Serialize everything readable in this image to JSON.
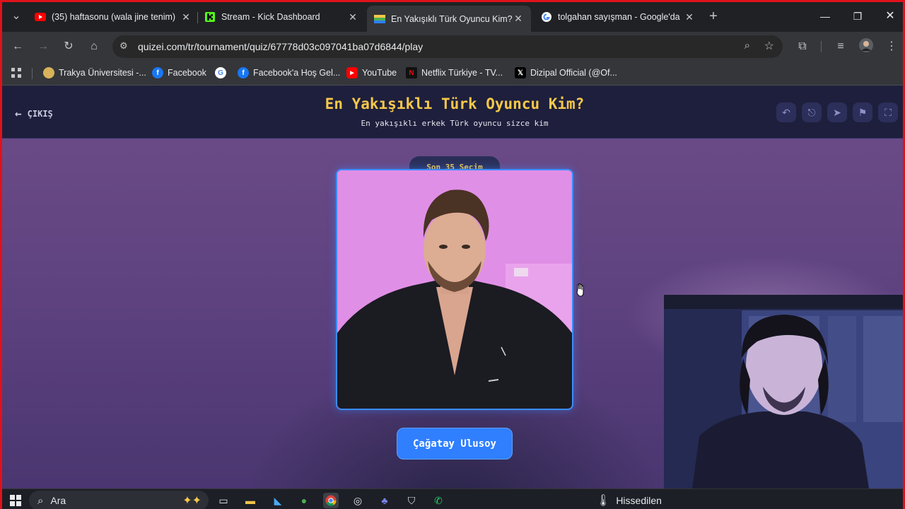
{
  "browser": {
    "tabs": [
      {
        "title": "(35) haftasonu (wala jine tenim)",
        "icon": "youtube-icon",
        "active": false
      },
      {
        "title": "Stream - Kick Dashboard",
        "icon": "kick-icon",
        "active": false
      },
      {
        "title": "En Yakışıklı Türk Oyuncu Kim? -",
        "icon": "quizei-icon",
        "active": true
      },
      {
        "title": "tolgahan sayışman - Google'da",
        "icon": "google-icon",
        "active": false
      }
    ],
    "url": "quizei.com/tr/tournament/quiz/67778d03c097041ba07d6844/play",
    "bookmarks": [
      {
        "label": "Trakya Üniversitesi -...",
        "icon": "trakya-icon"
      },
      {
        "label": "Facebook",
        "icon": "facebook-icon"
      },
      {
        "label": "",
        "icon": "google-icon"
      },
      {
        "label": "Facebook'a Hoş Gel...",
        "icon": "facebook-icon"
      },
      {
        "label": "YouTube",
        "icon": "youtube-icon"
      },
      {
        "label": "Netflix Türkiye - TV...",
        "icon": "netflix-icon"
      },
      {
        "label": "Dizipal Official (@Of...",
        "icon": "x-icon"
      }
    ]
  },
  "quiz": {
    "exit_label": "ÇIKIŞ",
    "title": "En Yakışıklı Türk Oyuncu Kim?",
    "subtitle": "En yakışıklı erkek Türk oyuncu sizce kim",
    "round_badge": "Son 35 Seçim",
    "choice_name": "Çağatay Ulusoy",
    "header_actions": [
      "undo-icon",
      "share-icon",
      "send-icon",
      "flag-icon",
      "fullscreen-icon"
    ]
  },
  "taskbar": {
    "search_placeholder": "Ara",
    "weather_text": "Hissedilen"
  },
  "colors": {
    "accent_blue": "#2f7fff",
    "title_yellow": "#f5c84a",
    "header_bg": "#1e1f3c",
    "frame_red": "#e0121b"
  }
}
